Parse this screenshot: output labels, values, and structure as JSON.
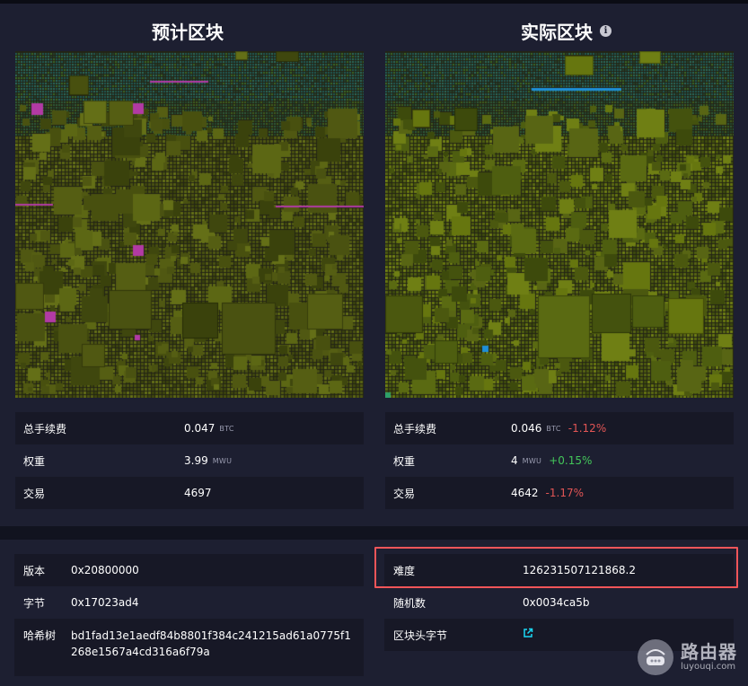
{
  "projected_block": {
    "title": "预计区块",
    "stats": [
      {
        "label": "总手续费",
        "value": "0.047",
        "unit": "BTC",
        "delta": ""
      },
      {
        "label": "权重",
        "value": "3.99",
        "unit": "MWU",
        "delta": ""
      },
      {
        "label": "交易",
        "value": "4697",
        "unit": "",
        "delta": ""
      }
    ]
  },
  "actual_block": {
    "title": "实际区块",
    "info_icon": "info-icon",
    "stats": [
      {
        "label": "总手续费",
        "value": "0.046",
        "unit": "BTC",
        "delta": "-1.12%",
        "delta_sign": "negative"
      },
      {
        "label": "权重",
        "value": "4",
        "unit": "MWU",
        "delta": "+0.15%",
        "delta_sign": "positive"
      },
      {
        "label": "交易",
        "value": "4642",
        "unit": "",
        "delta": "-1.17%",
        "delta_sign": "negative"
      }
    ]
  },
  "details": {
    "left": [
      {
        "label": "版本",
        "value": "0x20800000"
      },
      {
        "label": "字节",
        "value": "0x17023ad4"
      },
      {
        "label": "哈希树",
        "value": "bd1fad13e1aedf84b8801f384c241215ad61a0775f1268e1567a4cd316a6f79a"
      }
    ],
    "right": [
      {
        "label": "难度",
        "value": "126231507121868.2"
      },
      {
        "label": "随机数",
        "value": "0x0034ca5b"
      },
      {
        "label": "区块头字节",
        "value": "",
        "icon": "external-link-icon"
      }
    ]
  },
  "watermark": {
    "name": "路由器",
    "url": "luyouqi.com"
  },
  "colors": {
    "panel_bg": "#1d1f31",
    "row_dark": "#171826",
    "negative": "#e25555",
    "positive": "#43c65a",
    "link": "#1bd8f5",
    "highlight": "#f05559"
  }
}
